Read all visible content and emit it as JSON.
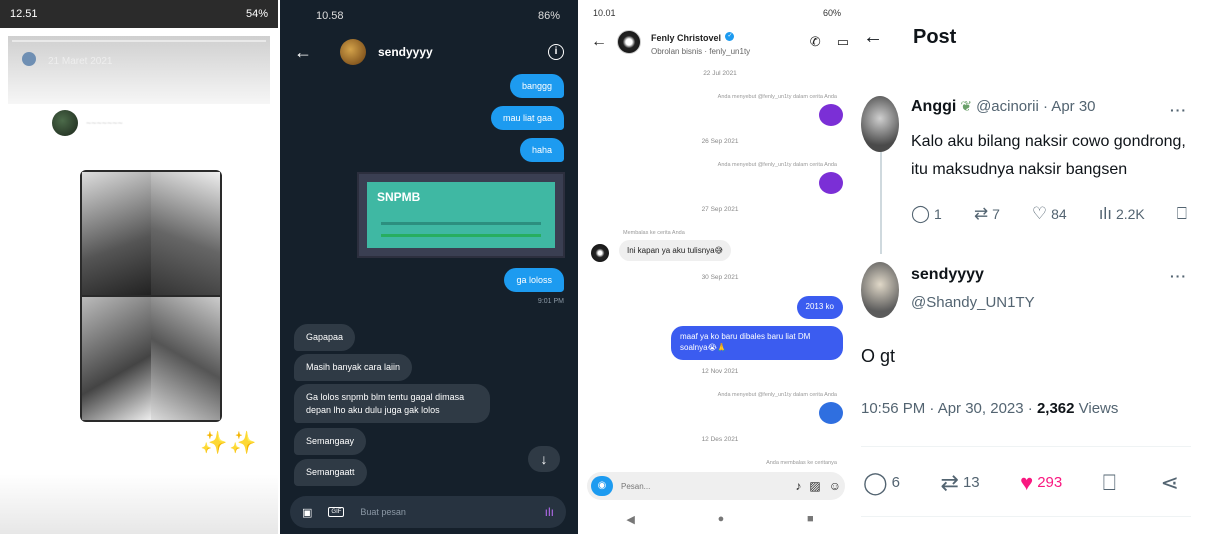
{
  "story": {
    "status_time": "12.51",
    "status_right": "54%",
    "date": "21 Maret 2021",
    "sparkles": "✨✨"
  },
  "dm_dark": {
    "status_time": "10.58",
    "status_battery": "86%",
    "contact_name": "sendyyyy",
    "out_messages": [
      "banggg",
      "mau liat gaa",
      "haha",
      "ga loloss"
    ],
    "shot_logo": "SNPMB",
    "time": "9:01 PM",
    "in_messages": [
      "Gapapaa",
      "Masih banyak cara laiin",
      "Ga lolos snpmb blm tentu gagal dimasa depan lho aku dulu juga gak lolos",
      "Semangaay",
      "Semangaatt"
    ],
    "composer_placeholder": "Buat pesan",
    "gif_label": "GIF"
  },
  "dm_ig": {
    "status_time": "10.01",
    "status_right": "60%",
    "contact_name": "Fenly Christovel",
    "contact_sub": "Obrolan bisnis · fenly_un1ty",
    "dates": [
      "22 Jul 2021",
      "26 Sep 2021",
      "27 Sep 2021",
      "30 Sep 2021",
      "12 Nov 2021",
      "12 Des 2021"
    ],
    "mention_note": "Anda menyebut @fenly_un1ty dalam cerita Anda",
    "reply_note": "Membalas ke cerita Anda",
    "in_message": "Ini kapan ya aku tulisnya😅",
    "out_message_1": "2013 ko",
    "out_message_2": "maaf ya ko baru dibales baru liat DM soalnya😭🙏",
    "bottom_note": "Anda membalas ke ceritanya",
    "composer_placeholder": "Pesan...",
    "colors": {
      "purple": "#7b2fd6",
      "blue": "#2f6fe0"
    }
  },
  "post": {
    "title": "Post",
    "tweet1": {
      "name": "Anggi",
      "handle": "@acinorii · Apr 30",
      "text": "Kalo aku bilang naksir cowo gondrong, itu maksudnya naksir bangsen",
      "replies": "1",
      "retweets": "7",
      "likes": "84",
      "views": "2.2K"
    },
    "tweet2": {
      "name": "sendyyyy",
      "handle": "@Shandy_UN1TY",
      "text": "O gt",
      "meta_prefix": "10:56 PM · Apr 30, 2023 · ",
      "views_count": "2,362",
      "views_label": " Views",
      "replies": "6",
      "retweets": "13",
      "likes": "293"
    },
    "more": "···"
  }
}
